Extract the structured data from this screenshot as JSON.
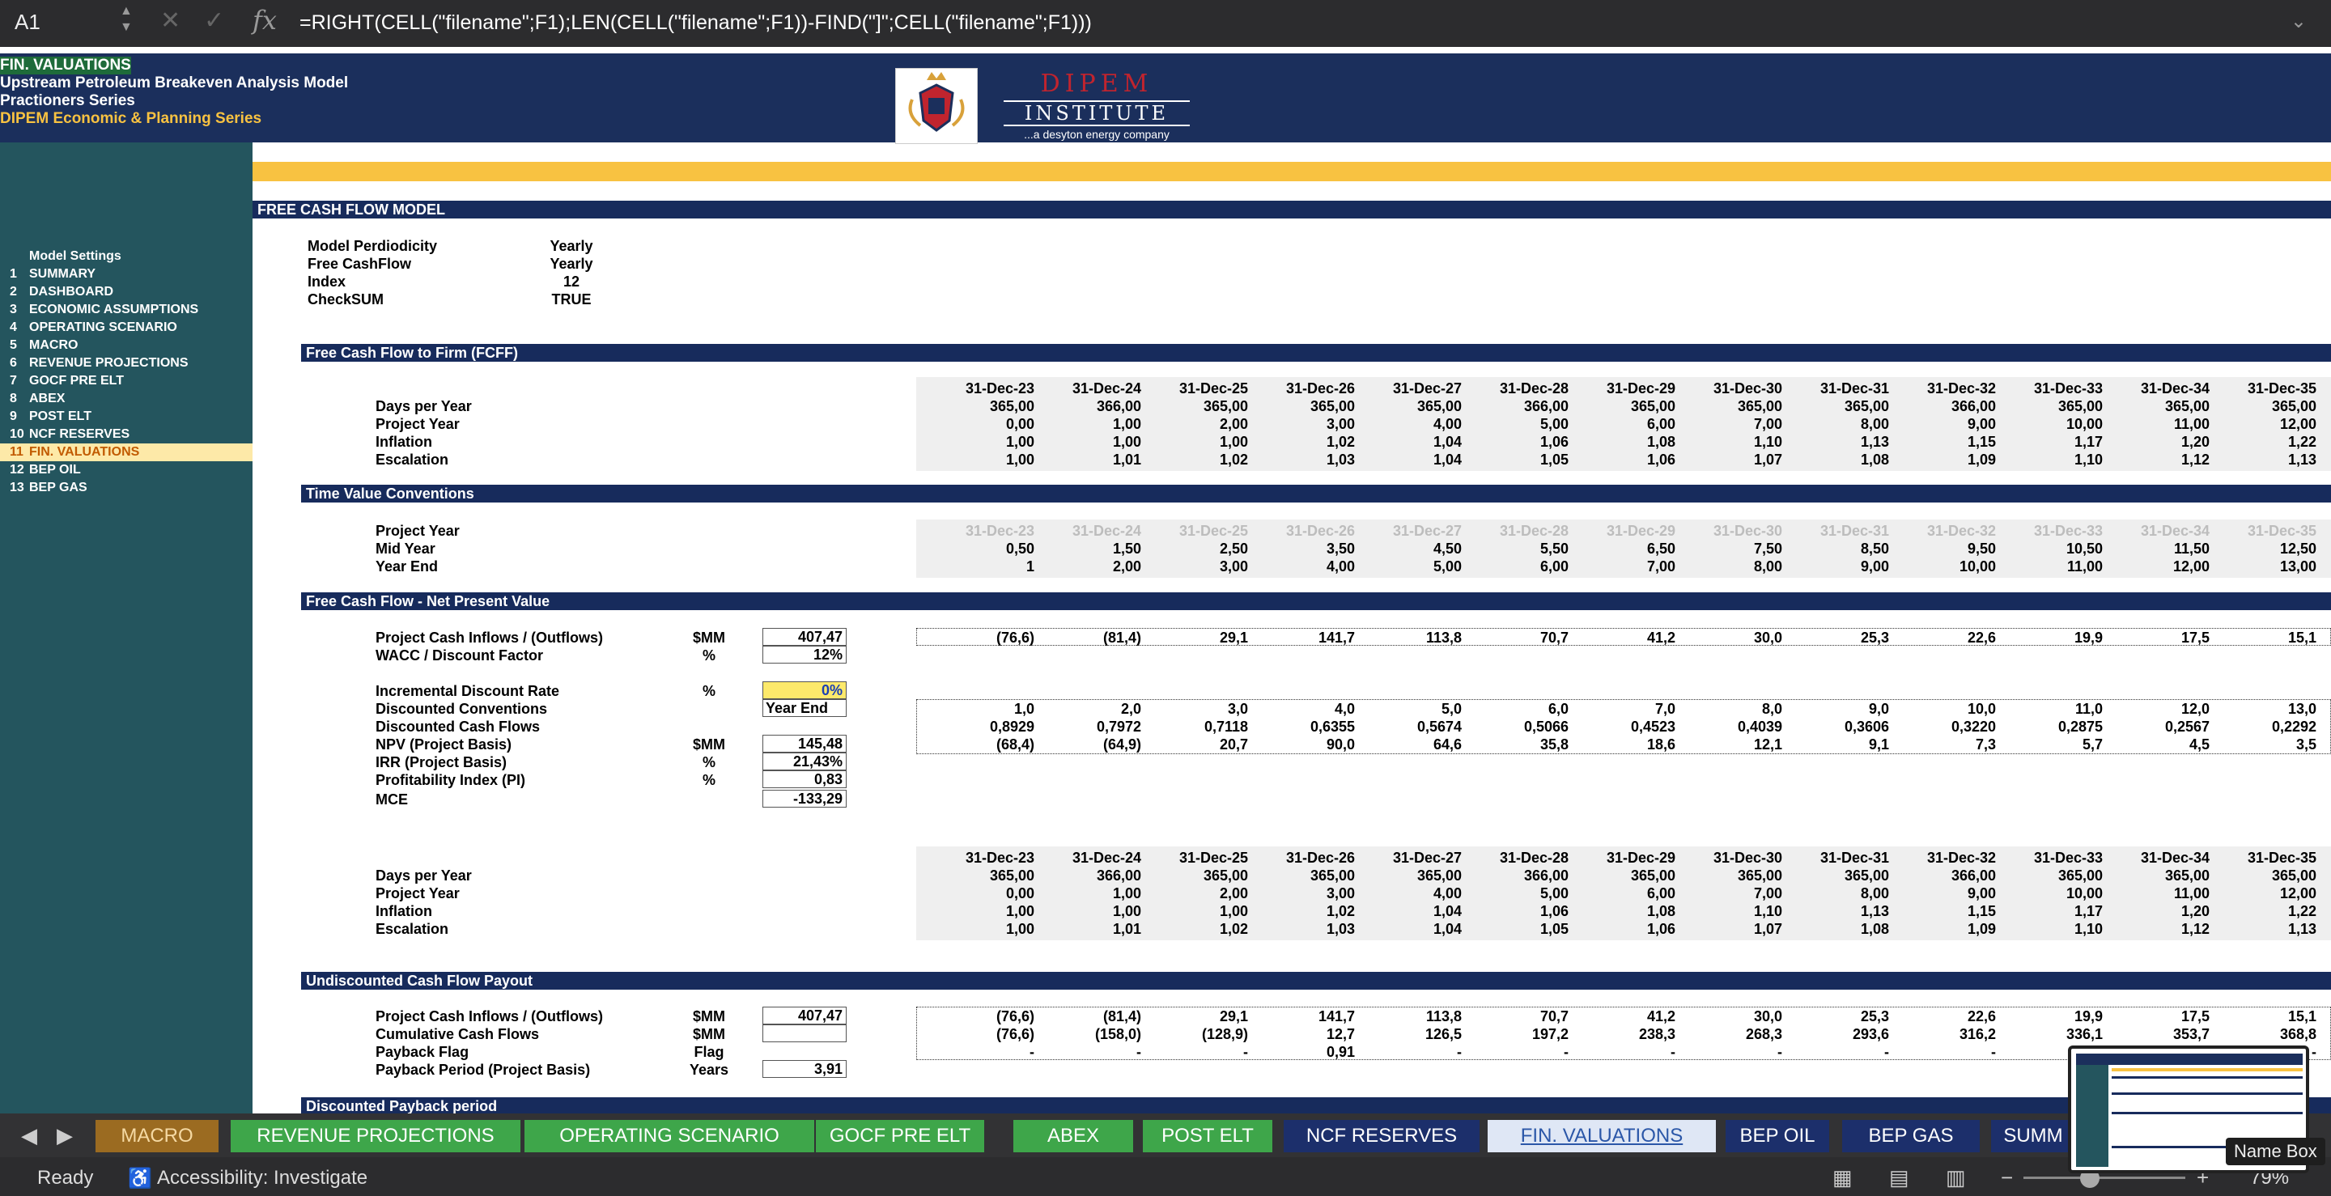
{
  "formula_bar": {
    "cell_ref": "A1",
    "formula": "=RIGHT(CELL(\"filename\";F1);LEN(CELL(\"filename\";F1))-FIND(\"]\";CELL(\"filename\";F1)))",
    "fx": "fx"
  },
  "banner": {
    "line1": "FIN. VALUATIONS",
    "line2": "Upstream Petroleum Breakeven Analysis Model",
    "line3": "Practioners Series",
    "line4": "DIPEM Economic & Planning Series",
    "brand": "DIPEM",
    "brand2": "INSTITUTE",
    "tagline": "...a desyton energy company"
  },
  "sidebar": {
    "title": "Model Settings",
    "items": [
      {
        "num": "1",
        "label": "SUMMARY"
      },
      {
        "num": "2",
        "label": "DASHBOARD"
      },
      {
        "num": "3",
        "label": "ECONOMIC ASSUMPTIONS"
      },
      {
        "num": "4",
        "label": "OPERATING SCENARIO"
      },
      {
        "num": "5",
        "label": "MACRO"
      },
      {
        "num": "6",
        "label": "REVENUE PROJECTIONS"
      },
      {
        "num": "7",
        "label": "GOCF PRE ELT"
      },
      {
        "num": "8",
        "label": "ABEX"
      },
      {
        "num": "9",
        "label": "POST ELT"
      },
      {
        "num": "10",
        "label": "NCF RESERVES"
      },
      {
        "num": "11",
        "label": "FIN. VALUATIONS"
      },
      {
        "num": "12",
        "label": "BEP OIL"
      },
      {
        "num": "13",
        "label": "BEP GAS"
      }
    ]
  },
  "main": {
    "title": "FREE CASH FLOW MODEL",
    "settings": [
      {
        "k": "Model Perdiodicity",
        "v": "Yearly"
      },
      {
        "k": "Free CashFlow",
        "v": "Yearly"
      },
      {
        "k": "Index",
        "v": "12"
      },
      {
        "k": "CheckSUM",
        "v": "TRUE"
      }
    ],
    "sections": {
      "fcff": "Free Cash Flow to Firm (FCFF)",
      "tvc": "Time Value Conventions",
      "npv": "Free Cash Flow - Net Present Value",
      "ucp": "Undiscounted Cash Flow Payout",
      "dpp": "Discounted  Payback period"
    },
    "dates": [
      "31-Dec-23",
      "31-Dec-24",
      "31-Dec-25",
      "31-Dec-26",
      "31-Dec-27",
      "31-Dec-28",
      "31-Dec-29",
      "31-Dec-30",
      "31-Dec-31",
      "31-Dec-32",
      "31-Dec-33",
      "31-Dec-34",
      "31-Dec-35"
    ],
    "fcff_rows": [
      {
        "label": "Days per Year",
        "values": [
          "365,00",
          "366,00",
          "365,00",
          "365,00",
          "365,00",
          "366,00",
          "365,00",
          "365,00",
          "365,00",
          "366,00",
          "365,00",
          "365,00",
          "365,00"
        ]
      },
      {
        "label": "Project Year",
        "values": [
          "0,00",
          "1,00",
          "2,00",
          "3,00",
          "4,00",
          "5,00",
          "6,00",
          "7,00",
          "8,00",
          "9,00",
          "10,00",
          "11,00",
          "12,00"
        ]
      },
      {
        "label": "Inflation",
        "values": [
          "1,00",
          "1,00",
          "1,00",
          "1,02",
          "1,04",
          "1,06",
          "1,08",
          "1,10",
          "1,13",
          "1,15",
          "1,17",
          "1,20",
          "1,22"
        ]
      },
      {
        "label": "Escalation",
        "values": [
          "1,00",
          "1,01",
          "1,02",
          "1,03",
          "1,04",
          "1,05",
          "1,06",
          "1,07",
          "1,08",
          "1,09",
          "1,10",
          "1,12",
          "1,13"
        ]
      }
    ],
    "tvc_rows": [
      {
        "label": "Project Year",
        "values": [
          "31-Dec-23",
          "31-Dec-24",
          "31-Dec-25",
          "31-Dec-26",
          "31-Dec-27",
          "31-Dec-28",
          "31-Dec-29",
          "31-Dec-30",
          "31-Dec-31",
          "31-Dec-32",
          "31-Dec-33",
          "31-Dec-34",
          "31-Dec-35"
        ]
      },
      {
        "label": "Mid Year",
        "values": [
          "0,50",
          "1,50",
          "2,50",
          "3,50",
          "4,50",
          "5,50",
          "6,50",
          "7,50",
          "8,50",
          "9,50",
          "10,50",
          "11,50",
          "12,50"
        ]
      },
      {
        "label": "Year End",
        "values": [
          "1",
          "2,00",
          "3,00",
          "4,00",
          "5,00",
          "6,00",
          "7,00",
          "8,00",
          "9,00",
          "10,00",
          "11,00",
          "12,00",
          "13,00"
        ]
      }
    ],
    "npv_rows": [
      {
        "label": "Project Cash Inflows / (Outflows)",
        "unit": "$MM",
        "box": "407,47",
        "values": [
          "(76,6)",
          "(81,4)",
          "29,1",
          "141,7",
          "113,8",
          "70,7",
          "41,2",
          "30,0",
          "25,3",
          "22,6",
          "19,9",
          "17,5",
          "15,1"
        ]
      },
      {
        "label": "WACC / Discount Factor",
        "unit": "%",
        "box": "12%"
      },
      {
        "label": "Incremental Discount Rate",
        "unit": "%",
        "box": "0%"
      },
      {
        "label": "Discounted Conventions",
        "box": "Year End",
        "values": [
          "1,0",
          "2,0",
          "3,0",
          "4,0",
          "5,0",
          "6,0",
          "7,0",
          "8,0",
          "9,0",
          "10,0",
          "11,0",
          "12,0",
          "13,0"
        ]
      },
      {
        "label": "Discounted Cash Flows",
        "values": [
          "0,8929",
          "0,7972",
          "0,7118",
          "0,6355",
          "0,5674",
          "0,5066",
          "0,4523",
          "0,4039",
          "0,3606",
          "0,3220",
          "0,2875",
          "0,2567",
          "0,2292"
        ]
      },
      {
        "label": "NPV (Project Basis)",
        "unit": "$MM",
        "box": "145,48",
        "values": [
          "(68,4)",
          "(64,9)",
          "20,7",
          "90,0",
          "64,6",
          "35,8",
          "18,6",
          "12,1",
          "9,1",
          "7,3",
          "5,7",
          "4,5",
          "3,5"
        ]
      },
      {
        "label": "IRR (Project Basis)",
        "unit": "%",
        "box": "21,43%"
      },
      {
        "label": "Profitability Index (PI)",
        "unit": "%",
        "box": "0,83"
      },
      {
        "label": "MCE",
        "box": "-133,29"
      }
    ],
    "ucp_rows": [
      {
        "label": "Project Cash Inflows / (Outflows)",
        "unit": "$MM",
        "box": "407,47",
        "values": [
          "(76,6)",
          "(81,4)",
          "29,1",
          "141,7",
          "113,8",
          "70,7",
          "41,2",
          "30,0",
          "25,3",
          "22,6",
          "19,9",
          "17,5",
          "15,1"
        ]
      },
      {
        "label": "Cumulative Cash Flows",
        "unit": "$MM",
        "box": "",
        "values": [
          "(76,6)",
          "(158,0)",
          "(128,9)",
          "12,7",
          "126,5",
          "197,2",
          "238,3",
          "268,3",
          "293,6",
          "316,2",
          "336,1",
          "353,7",
          "368,8"
        ]
      },
      {
        "label": "Payback Flag",
        "unit": "Flag",
        "values": [
          "-",
          "-",
          "-",
          "0,91",
          "-",
          "-",
          "-",
          "-",
          "-",
          "-",
          "-",
          "-",
          "-"
        ]
      },
      {
        "label": "Payback Period (Project Basis)",
        "unit": "Years",
        "box": "3,91"
      }
    ]
  },
  "tabs": [
    {
      "label": "MACRO",
      "style": "m"
    },
    {
      "label": "REVENUE PROJECTIONS",
      "style": "g"
    },
    {
      "label": "OPERATING SCENARIO",
      "style": "g"
    },
    {
      "label": "GOCF  PRE ELT",
      "style": "g"
    },
    {
      "label": "ABEX",
      "style": "g"
    },
    {
      "label": "POST ELT",
      "style": "g"
    },
    {
      "label": "NCF RESERVES",
      "style": "b"
    },
    {
      "label": "FIN. VALUATIONS",
      "style": "act"
    },
    {
      "label": "BEP OIL",
      "style": "b"
    },
    {
      "label": "BEP GAS",
      "style": "b"
    },
    {
      "label": "SUMM",
      "style": "b"
    }
  ],
  "status": {
    "ready": "Ready",
    "accessibility": "Accessibility: Investigate",
    "zoom": "79%",
    "tooltip": "Name Box"
  }
}
